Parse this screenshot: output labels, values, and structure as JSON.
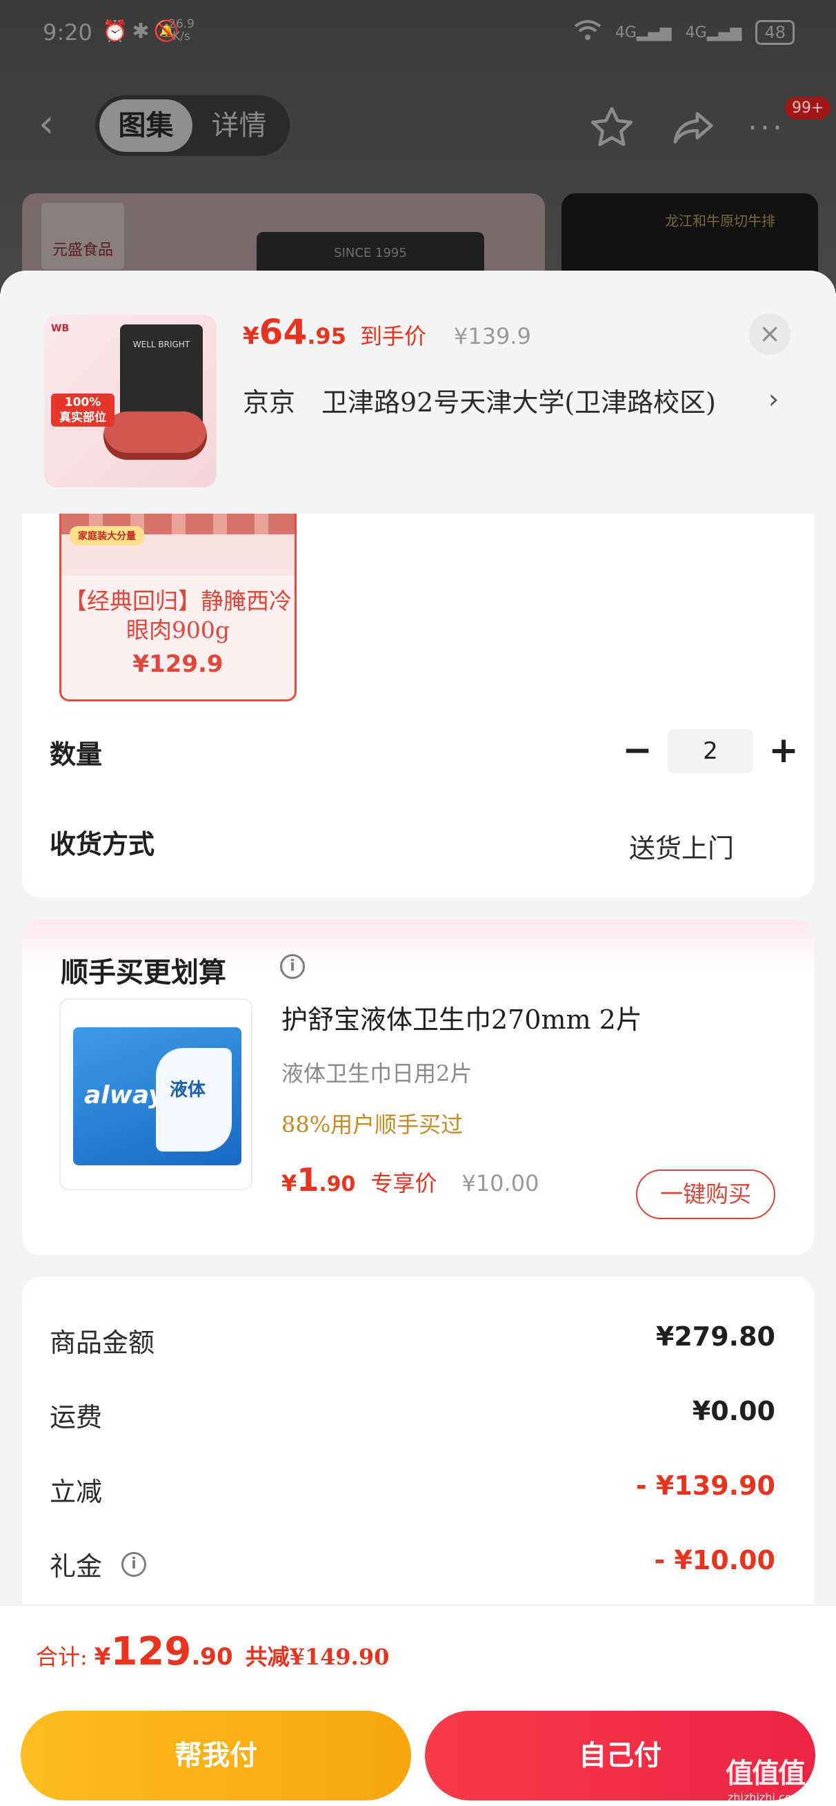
{
  "status_bar": {
    "time": "9:20",
    "speed": "26.9\nK/s",
    "net1": "4G",
    "net2": "4G",
    "battery": "48"
  },
  "nav": {
    "tabs": [
      "图集",
      "详情"
    ],
    "badge": "99+"
  },
  "background": {
    "brand": "元盛食品",
    "package_text": "SINCE 1995",
    "card2_text": "龙江和牛原切牛排"
  },
  "product": {
    "price_currency": "¥",
    "price_int": "64",
    "price_dec": ".95",
    "price_tag": "到手价",
    "orig_price": "¥139.9",
    "address": "京京　卫津路92号天津大学(卫津路校区)",
    "thumb_tag": "100%\n真实部位",
    "thumb_bag_text": "WELL BRIGHT"
  },
  "variant": {
    "chip": "家庭装大分量",
    "name": "【经典回归】静腌西冷眼肉900g",
    "price": "¥129.9"
  },
  "quantity": {
    "label": "数量",
    "value": "2",
    "minus": "−",
    "plus": "+"
  },
  "delivery": {
    "label": "收货方式",
    "value": "送货上门"
  },
  "addon": {
    "title": "顺手买更划算",
    "name": "护舒宝液体卫生巾270mm 2片",
    "desc": "液体卫生巾日用2片",
    "hint": "88%用户顺手买过",
    "price_currency": "¥",
    "price_int": "1",
    "price_dec": ".90",
    "price_tag": "专享价",
    "orig_price": "¥10.00",
    "buy_label": "一键购买",
    "pack_brand": "always",
    "pack_cn": "液体"
  },
  "summary": {
    "rows": [
      {
        "label": "商品金额",
        "value": "¥279.80"
      },
      {
        "label": "运费",
        "value": "¥0.00"
      },
      {
        "label": "立减",
        "value": "- ¥139.90"
      },
      {
        "label": "礼金",
        "value": "- ¥10.00"
      }
    ]
  },
  "footer": {
    "total_label": "合计:",
    "total_currency": "¥",
    "total_int": "129",
    "total_dec": ".90",
    "saved": "共减¥149.90",
    "help_pay": "帮我付",
    "self_pay": "自己付",
    "watermark": "值值值",
    "watermark_url": "zhizhizhi.com"
  },
  "colors": {
    "accent": "#e8331f",
    "help_button": "#fdbd1e",
    "self_button": "#f63b49"
  }
}
